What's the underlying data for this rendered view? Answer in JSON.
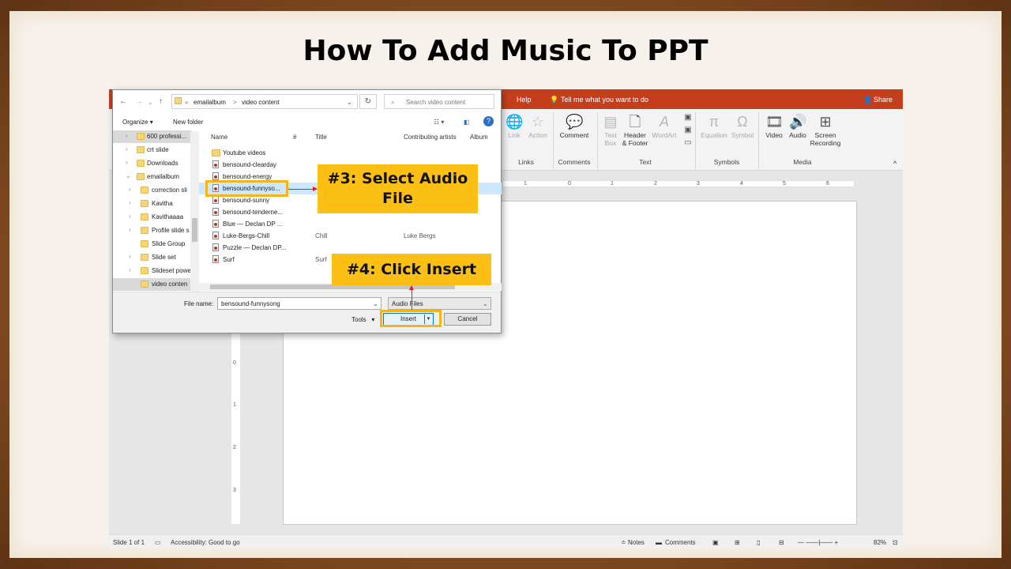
{
  "slide": {
    "title": "How To Add Music To PPT"
  },
  "ppt": {
    "menu": {
      "help": "Help",
      "tell_me": "Tell me what you want to do",
      "share": "Share"
    },
    "ribbon": {
      "link": "Link",
      "action": "Action",
      "comment": "Comment",
      "text_box_1": "Text",
      "text_box_2": "Box",
      "header_footer_1": "Header",
      "header_footer_2": "& Footer",
      "wordart": "WordArt",
      "equation": "Equation",
      "symbol": "Symbol",
      "video": "Video",
      "audio": "Audio",
      "screen_recording_1": "Screen",
      "screen_recording_2": "Recording",
      "groups": {
        "links": "Links",
        "comments": "Comments",
        "text": "Text",
        "symbols": "Symbols",
        "media": "Media"
      }
    },
    "ruler": [
      "1",
      "0",
      "1",
      "2",
      "3",
      "4",
      "5",
      "6"
    ],
    "vruler": [
      "0",
      "1",
      "2",
      "3"
    ],
    "status": {
      "slide_count": "Slide 1 of 1",
      "accessibility": "Accessibility: Good to go",
      "notes": "Notes",
      "comments": "Comments",
      "zoom": "82%"
    }
  },
  "dialog": {
    "breadcrumb": {
      "prefix": "«",
      "folder1": "emailalbum",
      "sep": ">",
      "folder2": "video content"
    },
    "search_placeholder": "Search video content",
    "organize": "Organize",
    "new_folder": "New folder",
    "tree": [
      "600 professi...",
      "crt slide",
      "Downloads",
      "emailalbum",
      "correction sli",
      "Kavitha",
      "Kavithaaaa",
      "Profile slide s",
      "Slide Group",
      "Slide set",
      "Slideset powe",
      "video conten"
    ],
    "columns": {
      "name": "Name",
      "number": "#",
      "title": "Title",
      "artists": "Contributing artists",
      "album": "Album"
    },
    "files": [
      {
        "name": "Youtube videos",
        "title": "",
        "artist": ""
      },
      {
        "name": "bensound-clearday",
        "title": "",
        "artist": ""
      },
      {
        "name": "bensound-energy",
        "title": "",
        "artist": ""
      },
      {
        "name": "bensound-funnyso...",
        "title": "",
        "artist": ""
      },
      {
        "name": "bensound-sunny",
        "title": "",
        "artist": ""
      },
      {
        "name": "bensound-tenderne...",
        "title": "",
        "artist": ""
      },
      {
        "name": "Blue — Declan DP ...",
        "title": "",
        "artist": ""
      },
      {
        "name": "Luke-Bergs-Chill",
        "title": "Chill",
        "artist": "Luke Bergs"
      },
      {
        "name": "Puzzle — Declan DP...",
        "title": "",
        "artist": ""
      },
      {
        "name": "Surf",
        "title": "Surf",
        "artist": ""
      }
    ],
    "file_name_label": "File name:",
    "file_name_value": "bensound-funnysong",
    "file_type": "Audio Files",
    "tools": "Tools",
    "insert": "Insert",
    "cancel": "Cancel"
  },
  "callouts": {
    "step3_line1": "#3: Select Audio",
    "step3_line2": "File",
    "step4": "#4: Click Insert"
  }
}
